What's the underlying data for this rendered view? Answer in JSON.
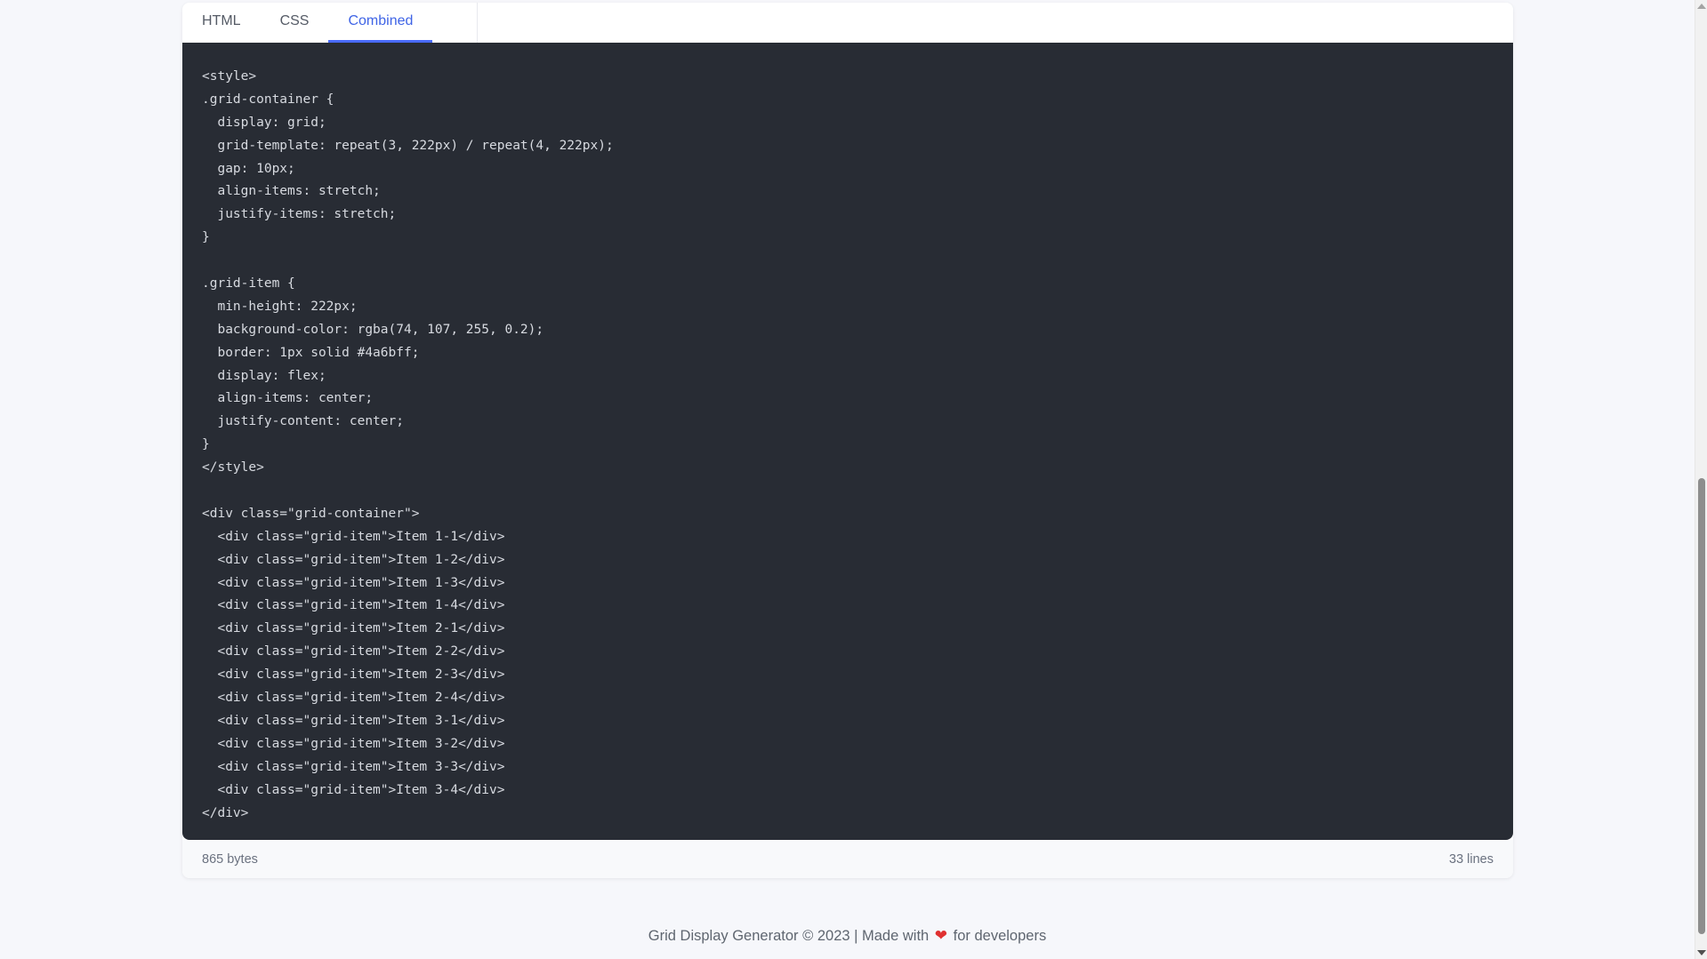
{
  "tabs": [
    {
      "label": "HTML",
      "active": false
    },
    {
      "label": "CSS",
      "active": false
    },
    {
      "label": "Combined",
      "active": true
    }
  ],
  "code_lines": [
    "<style>",
    ".grid-container {",
    "  display: grid;",
    "  grid-template: repeat(3, 222px) / repeat(4, 222px);",
    "  gap: 10px;",
    "  align-items: stretch;",
    "  justify-items: stretch;",
    "}",
    "",
    ".grid-item {",
    "  min-height: 222px;",
    "  background-color: rgba(74, 107, 255, 0.2);",
    "  border: 1px solid #4a6bff;",
    "  display: flex;",
    "  align-items: center;",
    "  justify-content: center;",
    "}",
    "</style>",
    "",
    "<div class=\"grid-container\">",
    "  <div class=\"grid-item\">Item 1-1</div>",
    "  <div class=\"grid-item\">Item 1-2</div>",
    "  <div class=\"grid-item\">Item 1-3</div>",
    "  <div class=\"grid-item\">Item 1-4</div>",
    "  <div class=\"grid-item\">Item 2-1</div>",
    "  <div class=\"grid-item\">Item 2-2</div>",
    "  <div class=\"grid-item\">Item 2-3</div>",
    "  <div class=\"grid-item\">Item 2-4</div>",
    "  <div class=\"grid-item\">Item 3-1</div>",
    "  <div class=\"grid-item\">Item 3-2</div>",
    "  <div class=\"grid-item\">Item 3-3</div>",
    "  <div class=\"grid-item\">Item 3-4</div>",
    "</div>"
  ],
  "stats": {
    "size": "865 bytes",
    "lines": "33 lines"
  },
  "footer": {
    "prefix": "Grid Display Generator © 2023 | Made with",
    "suffix": "for developers",
    "heart_icon": "heart-icon"
  },
  "colors": {
    "accent": "#4a6bff",
    "code_bg": "#282c34",
    "heart": "#e03131"
  }
}
